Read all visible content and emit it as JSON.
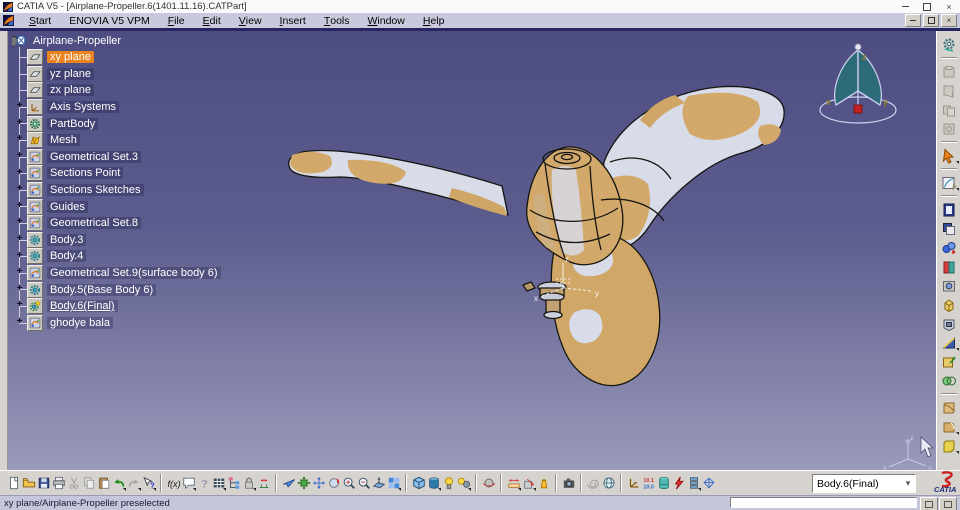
{
  "titlebar": {
    "title": "CATIA V5 - [Airplane-Propeller.6(1401.11.16).CATPart]"
  },
  "menubar": {
    "items": [
      {
        "label": "Start",
        "key": "S"
      },
      {
        "label": "ENOVIA V5 VPM",
        "key": null
      },
      {
        "label": "File",
        "key": "F"
      },
      {
        "label": "Edit",
        "key": "E"
      },
      {
        "label": "View",
        "key": "V"
      },
      {
        "label": "Insert",
        "key": "I"
      },
      {
        "label": "Tools",
        "key": "T"
      },
      {
        "label": "Window",
        "key": "W"
      },
      {
        "label": "Help",
        "key": "H"
      }
    ]
  },
  "tree": {
    "root": {
      "label": "Airplane-Propeller",
      "icon": "part"
    },
    "items": [
      {
        "label": "xy plane",
        "icon": "plane",
        "selected": true
      },
      {
        "label": "yz plane",
        "icon": "plane"
      },
      {
        "label": "zx plane",
        "icon": "plane"
      },
      {
        "label": "Axis Systems",
        "icon": "axis",
        "expandable": true
      },
      {
        "label": "PartBody",
        "icon": "partbody",
        "expandable": true
      },
      {
        "label": "Mesh",
        "icon": "mesh",
        "expandable": true
      },
      {
        "label": "Geometrical Set.3",
        "icon": "geoset",
        "expandable": true
      },
      {
        "label": "Sections Point",
        "icon": "geoset",
        "expandable": true
      },
      {
        "label": "Sections Sketches",
        "icon": "geoset",
        "expandable": true
      },
      {
        "label": "Guides",
        "icon": "geoset",
        "expandable": true
      },
      {
        "label": "Geometrical Set.8",
        "icon": "geoset",
        "expandable": true
      },
      {
        "label": "Body.3",
        "icon": "body",
        "expandable": true
      },
      {
        "label": "Body.4",
        "icon": "body",
        "expandable": true
      },
      {
        "label": "Geometrical Set.9(surface body 6)",
        "icon": "geoset",
        "expandable": true
      },
      {
        "label": "Body.5(Base Body 6)",
        "icon": "body",
        "expandable": true
      },
      {
        "label": "Body.6(Final)",
        "icon": "body-final",
        "expandable": true,
        "underlined": true
      },
      {
        "label": "ghodye bala",
        "icon": "geoset",
        "expandable": true
      }
    ]
  },
  "viewport": {
    "compass": {
      "x": "x",
      "y": "y",
      "z": "z"
    },
    "axis_marker": {
      "x": "x",
      "y": "y",
      "z": "z"
    },
    "triad": {
      "x": "x",
      "y": "y",
      "z": "z"
    }
  },
  "right_toolbar": {
    "icons": [
      "update-tool",
      "sep",
      "gray-tool-1",
      "gray-tool-2",
      "gray-tool-3",
      "gray-tool-4",
      "sep",
      "select-arrow",
      "sep",
      "sketcher",
      "sep",
      "notebook",
      "image-layers",
      "spheres-tool",
      "catalog-book",
      "frame-box",
      "pad",
      "pocket",
      "slope",
      "surface-sketch",
      "boolean-operations",
      "sep",
      "fillet-a",
      "fillet-b",
      "chamfer"
    ]
  },
  "bottom_toolbar": {
    "groups": [
      [
        "new-document",
        "open",
        "save",
        "print",
        "cut",
        "copy",
        "paste",
        "undo",
        "redo",
        "whats-this"
      ],
      [
        "formula-fx",
        "comment",
        "knowledge-help",
        "design-table",
        "tree-structure",
        "lock",
        "equivalent-dimensions"
      ],
      [
        "fly-mode",
        "fit-all-in",
        "pan",
        "rotate-view",
        "zoom-in",
        "zoom-out",
        "normal-view",
        "quad-view"
      ],
      [
        "iso-view",
        "shading-mode",
        "hide-show",
        "swap-visible-space"
      ],
      [
        "turntable"
      ],
      [
        "measure-between",
        "measure-item",
        "measure-inertia"
      ],
      [
        "capture-image"
      ],
      [
        "spiral-tool",
        "globe-tool"
      ],
      [
        "axis-system",
        "tolerance",
        "catalog",
        "knowledge-flash",
        "rule-stack",
        "wireframe-box"
      ]
    ],
    "flyout_icons": [
      "undo",
      "redo",
      "whats-this",
      "comment",
      "design-table",
      "lock",
      "quad-view",
      "shading-mode",
      "swap-visible-space",
      "measure-between",
      "measure-item",
      "rule-stack",
      "select-arrow",
      "sketcher",
      "slope",
      "chamfer",
      "fillet-b"
    ],
    "glyphs": {
      "fx": "f(x)",
      "question": "?"
    },
    "tolerance_text": {
      "top": "10.1",
      "bottom": "10.0"
    },
    "body_selector": {
      "value": "Body.6(Final)"
    },
    "brand": {
      "name": "CATIA"
    }
  },
  "statusbar": {
    "message": "xy plane/Airplane-Propeller preselected",
    "input_value": ""
  },
  "colors": {
    "selection_orange": "#e8831d",
    "viewport_top": "#4d4d82",
    "viewport_bottom": "#9a9aba",
    "model_tan": "#d2a96b",
    "model_light": "#d8dbe8",
    "compass_fill": "#2e6b78"
  }
}
